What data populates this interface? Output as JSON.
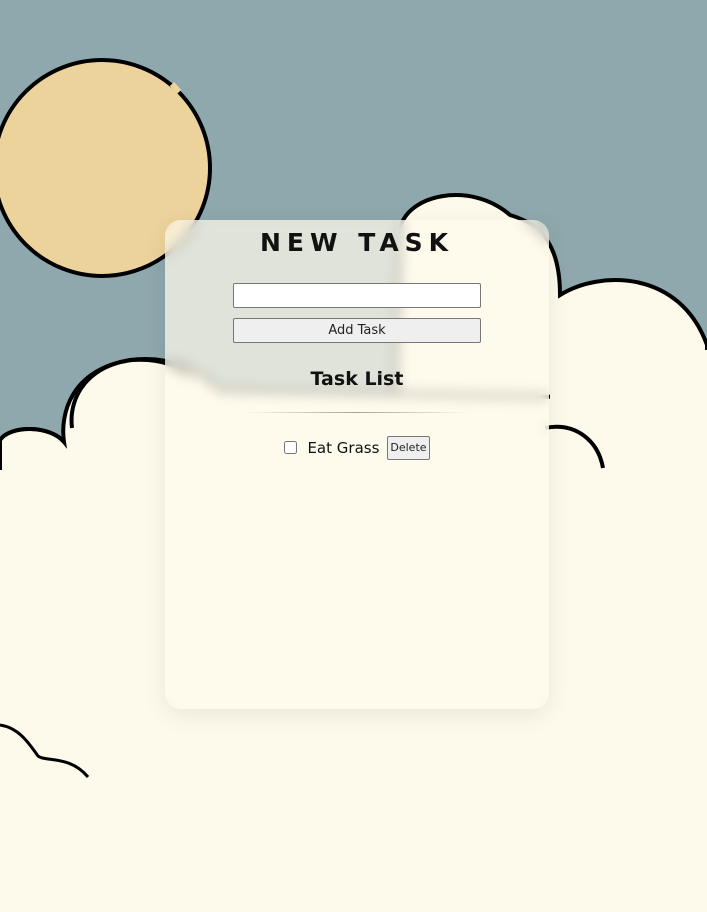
{
  "form": {
    "title": "NEW TASK",
    "input_value": "",
    "input_placeholder": "",
    "add_button_label": "Add Task"
  },
  "list": {
    "title": "Task List",
    "items": [
      {
        "text": "Eat Grass",
        "checked": false,
        "delete_label": "Delete"
      }
    ]
  },
  "colors": {
    "sky": "#8fa8ad",
    "sun": "#ecd39c",
    "cloud": "#fdf9eb",
    "outline": "#000000"
  }
}
